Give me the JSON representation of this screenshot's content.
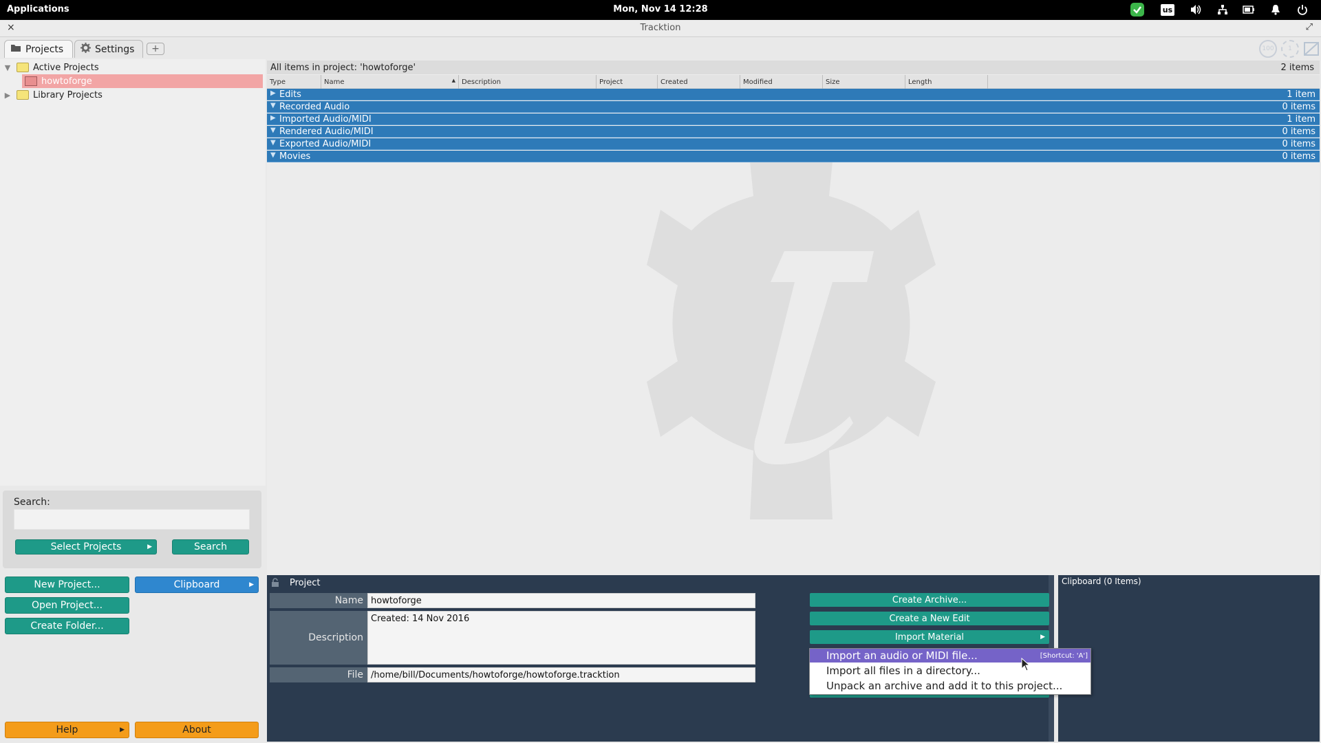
{
  "system_bar": {
    "apps_label": "Applications",
    "clock": "Mon, Nov 14    12:28",
    "keyboard_layout": "us",
    "icons": [
      "check-icon",
      "keyboard-layout-icon",
      "volume-icon",
      "network-icon",
      "battery-icon",
      "bell-icon",
      "power-icon"
    ]
  },
  "window": {
    "title": "Tracktion",
    "close_glyph": "×",
    "expand_glyph": "⤢"
  },
  "tabs": [
    {
      "label": "Projects",
      "icon": "folder-icon"
    },
    {
      "label": "Settings",
      "icon": "gear-icon"
    }
  ],
  "tab_add_glyph": "+",
  "tree": {
    "active_projects": "Active Projects",
    "selected_project": "howtoforge",
    "library_projects": "Library Projects"
  },
  "content": {
    "header": "All items in project: 'howtoforge'",
    "count": "2 items",
    "columns": [
      "Type",
      "Name",
      "Description",
      "Project",
      "Created",
      "Modified",
      "Size",
      "Length"
    ],
    "sort_arrow": "▲",
    "categories": [
      {
        "label": "Edits",
        "count": "1 item",
        "tri": "▶"
      },
      {
        "label": "Recorded Audio",
        "count": "0 items",
        "tri": "▼"
      },
      {
        "label": "Imported Audio/MIDI",
        "count": "1 item",
        "tri": "▶"
      },
      {
        "label": "Rendered Audio/MIDI",
        "count": "0 items",
        "tri": "▼"
      },
      {
        "label": "Exported Audio/MIDI",
        "count": "0 items",
        "tri": "▼"
      },
      {
        "label": "Movies",
        "count": "0 items",
        "tri": "▼"
      }
    ]
  },
  "search": {
    "label": "Search:",
    "value": "",
    "select_projects": "Select Projects",
    "search_button": "Search"
  },
  "left_buttons": {
    "new_project": "New Project...",
    "clipboard": "Clipboard",
    "open_project": "Open Project...",
    "create_folder": "Create Folder...",
    "help": "Help",
    "about": "About"
  },
  "project_panel": {
    "title": "Project",
    "name_label": "Name",
    "name_value": "howtoforge",
    "description_label": "Description",
    "description_value": "Created: 14 Nov 2016",
    "file_label": "File",
    "file_value": "/home/bill/Documents/howtoforge/howtoforge.tracktion",
    "create_archive": "Create Archive...",
    "create_edit": "Create a New Edit",
    "import_material": "Import Material"
  },
  "clipboard_panel": {
    "title": "Clipboard (0 Items)"
  },
  "context_menu": {
    "items": [
      {
        "label": "Import an audio or MIDI file...",
        "shortcut": "[Shortcut: 'A']"
      },
      {
        "label": "Import all files in a directory...",
        "shortcut": ""
      },
      {
        "label": "Unpack an archive and add it to this project...",
        "shortcut": ""
      }
    ]
  },
  "colors": {
    "category_row": "#2e7ab8",
    "teal_button": "#1e9a88",
    "blue_button": "#2f87cf",
    "orange_button": "#f49c1a",
    "panel_bg": "#2b3b4f",
    "menu_highlight": "#7563c8",
    "selected_project": "#f2a5a5"
  }
}
